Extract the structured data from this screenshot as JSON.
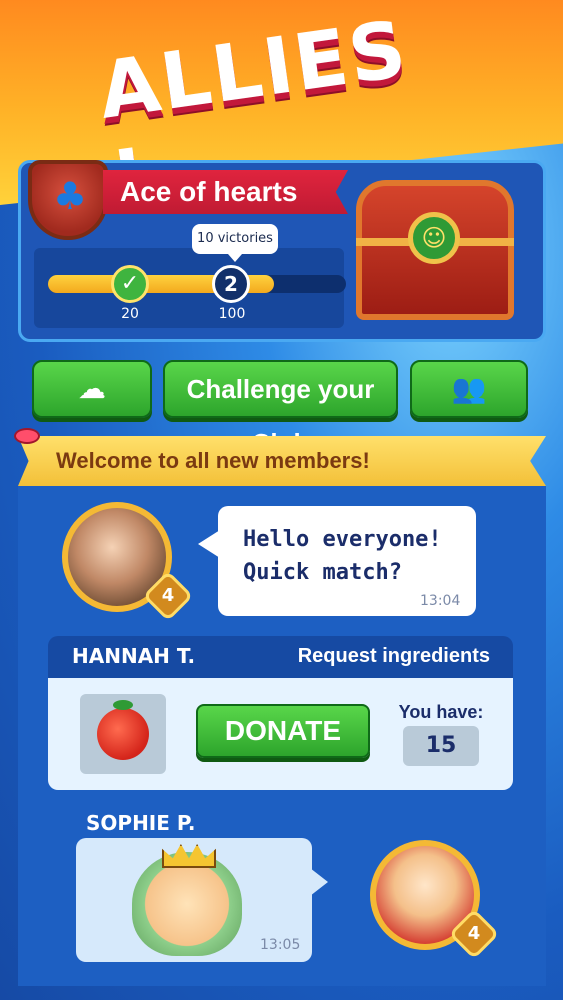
{
  "title": "ALLIES !",
  "club": {
    "name": "Ace of hearts",
    "suit_icon": "club-icon",
    "progress": {
      "fraction": 0.76,
      "tooltip": "10 victories",
      "milestones": [
        {
          "label": "20",
          "status": "completed"
        },
        {
          "label": "100",
          "badge": "2",
          "status": "current"
        }
      ]
    },
    "chest_icon": "treasure-chest-icon"
  },
  "buttons": {
    "chef_icon": "chef-hat-icon",
    "challenge_label": "Challenge your Club",
    "members_icon": "members-icon"
  },
  "announcement": "Welcome to all new members!",
  "messages": [
    {
      "avatar": "player-photo",
      "level": "4",
      "text_line1": "Hello everyone!",
      "text_line2": "Quick match?",
      "time": "13:04"
    }
  ],
  "request": {
    "name": "HANNAH T.",
    "type": "Request ingredients",
    "ingredient_icon": "tomato-icon",
    "donate_label": "DONATE",
    "have_label": "You have:",
    "have_count": "15"
  },
  "sophie": {
    "name": "SOPHIE P.",
    "sticker": "king-sticker",
    "time": "13:05",
    "level": "4"
  },
  "colors": {
    "accent_green": "#2da52c",
    "banner_red": "#c01b33",
    "banner_yellow": "#f3c038",
    "panel_blue": "#1f56b6"
  }
}
